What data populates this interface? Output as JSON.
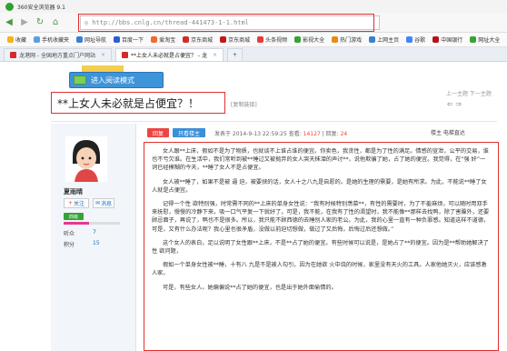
{
  "browser": {
    "title": "360安全浏览器 9.1",
    "url": "http://bbs.cnlg.cn/thread-441473-1-1.html",
    "bookmarks": [
      "收藏",
      "手机收藏夹",
      "网址导航",
      "百度一下",
      "爱淘宝",
      "京东商城",
      "京东商城",
      "头条视频",
      "影视大全",
      "热门游戏",
      "上网主页",
      "谷歌",
      "中国银行",
      "网址大全",
      "常"
    ],
    "tabs": [
      "龙港网 - 全国地方重点门户网站",
      "**上女人未必就是占便宜？ - 龙"
    ]
  },
  "page": {
    "reader_mode": "进入阅读模式",
    "thread_title": "**上女人未必就是占便宜？！",
    "title_tag": "[复制链接]",
    "top_links": "上一主题  下一主题",
    "page_controls": "⇐  ⇒"
  },
  "author": {
    "name": "夏雨晴",
    "follow": "关注",
    "message": "消息",
    "level": "四级",
    "level_progress": 0.45,
    "stats": [
      {
        "label": "听众",
        "value": "7"
      },
      {
        "label": "积分",
        "value": "15"
      }
    ]
  },
  "post": {
    "reply": "回复",
    "only_author": "只看楼主",
    "meta_prefix": "发表于 2014-9-13 22:59:25  查看:",
    "views": "14127",
    "replies_label": "回复:",
    "replies": "24",
    "floor": "楼主  电梯直达",
    "paragraphs": [
      "女人跟**上床，假如不是为了物质，也就谈不上谁占谁的便宜。你卖色，我贪性，都是为了性的满足。情感的宣泄，公平的交易，谁也不亏欠谁。在生活中，我们常听到被**睡过又被抛弃的女人哭天抹泪的声讨**，说他欺骗了她，占了她的便宜。我觉得，在“强 奸”一词已经模糊的今天，**睡了女人不是占便宜。",
      "女人被**睡了，如果不是被 逼 迫，被要挟的话，女人十之八九是自愿的。是她的生理的需要，是她有所求。为此，不能说**睡了女人就是占便宜。",
      "记得一个性 欲特别强，时常需不同的**上床的单身女性说：“我有时候特别羡慕**，有性的需要时，为了不羞麻烦，可以随时用双手来抚慰，慢慢的冷静下来，吸一口气平复一下就好了，可是，我不能，在我有了性的渴望时，我不能像**那样去找鸭，除了害臊外，还要顾忌面子，再说了，鸭也不是很多。所以，我只能不顾西德的去睡别人家的老公。为此，我的心里一直有一种负罪感。知道这样不道德，可是，又有什么办法呢？我心里也很矛盾，没做以前迫切想做，做过了又后悔，后悔过后还想做。”",
      "这个女人的表白，足以说明了女性跟**上床，不是**占了她的便宜。有些时候可以说是，是她占了**的便宜。因为是**帮助她解决了性 欲问题，",
      "假如一个单身女性被**睡，十有八 九是不是被人勾引，因为在她欲 火中烧的时候，家里没有天火的工具。人家他她灭火，应该感激人家。",
      "可是，有些女人，她偏偏说**占了她的便宜，也是出于她外面偷情的。"
    ]
  }
}
